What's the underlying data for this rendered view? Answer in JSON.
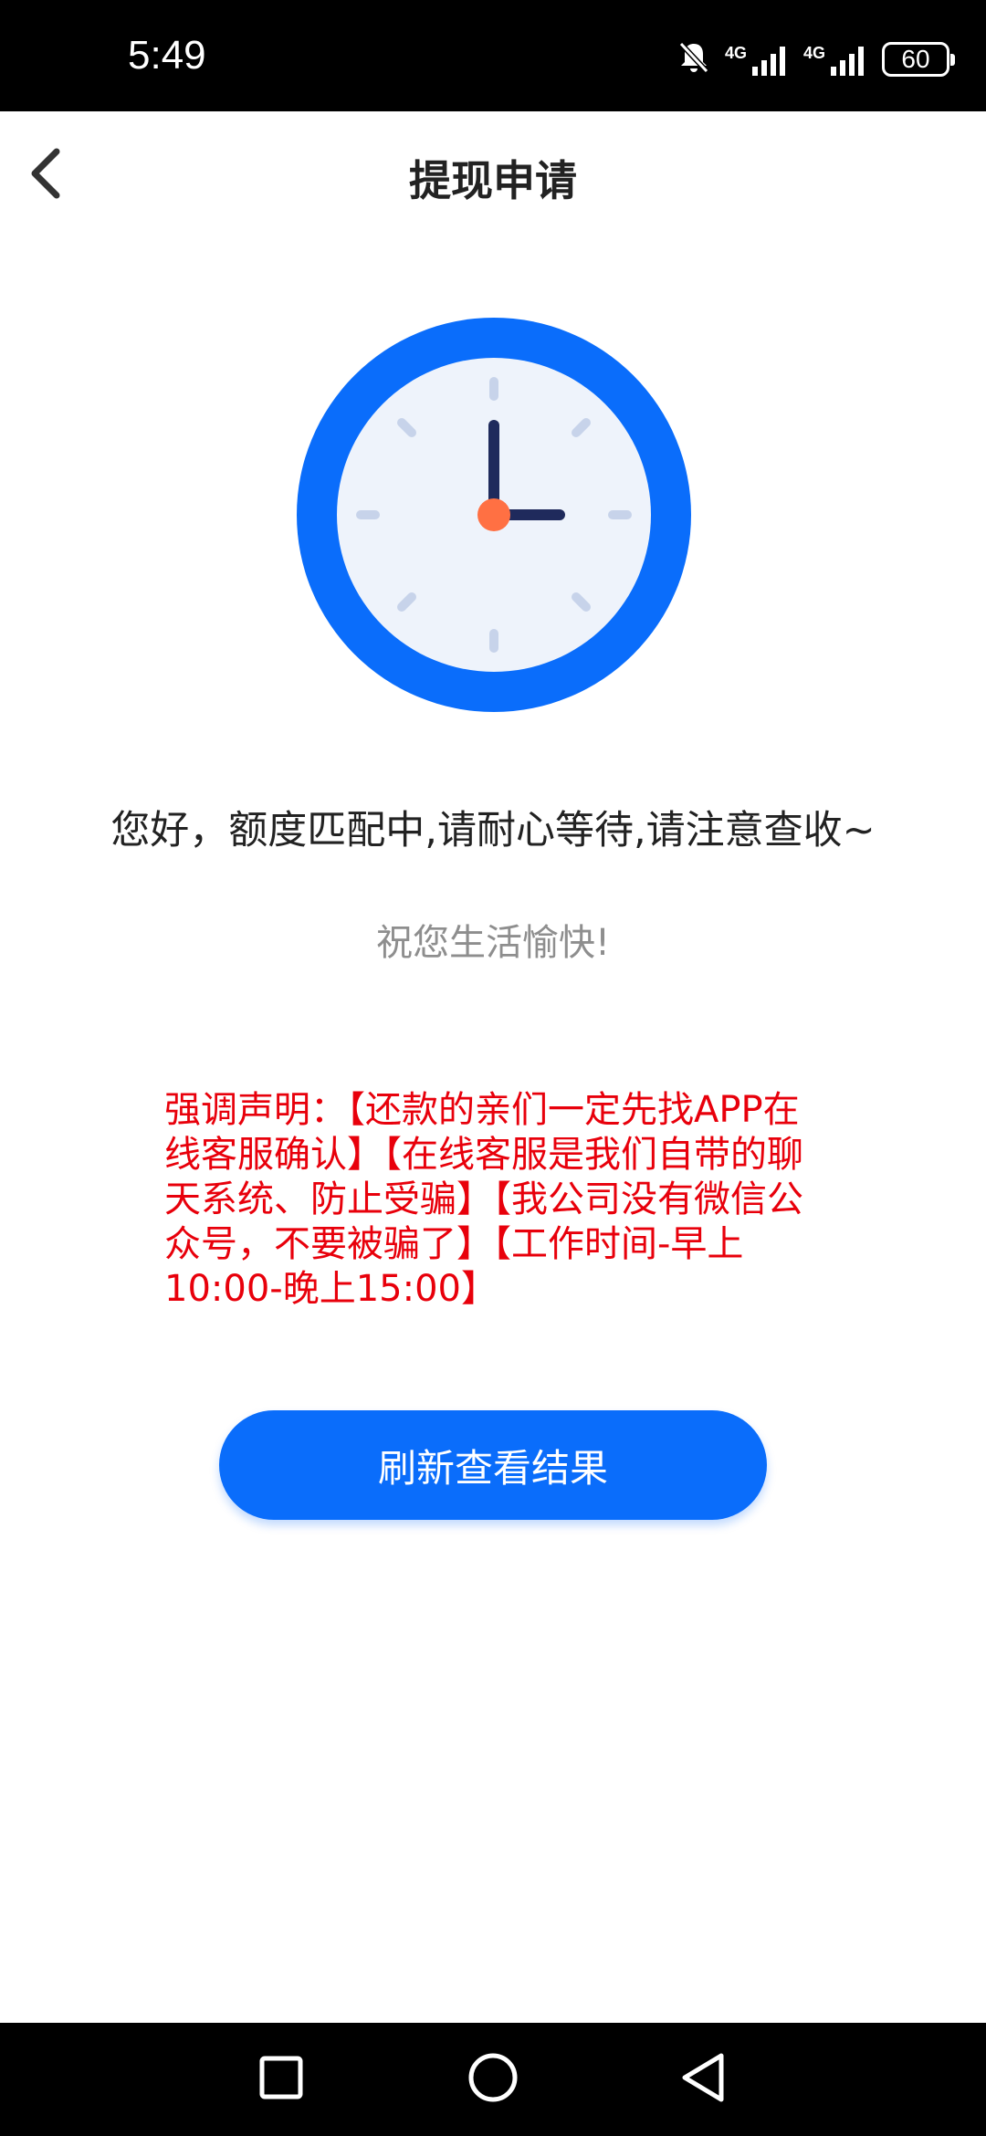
{
  "status_bar": {
    "time": "5:49",
    "net1_label": "4G",
    "net2_label": "4G",
    "battery": "60",
    "icons": [
      "bell-muted-icon",
      "signal-icon",
      "signal-icon",
      "battery-icon"
    ]
  },
  "header": {
    "title": "提现申请",
    "back_icon": "chevron-left-icon"
  },
  "content": {
    "illustration": "clock-icon",
    "main_message": "您好，额度匹配中,请耐心等待,请注意查收~",
    "sub_message": "祝您生活愉快!",
    "notice": "强调声明：【还款的亲们一定先找APP在线客服确认】【在线客服是我们自带的聊天系统、防止受骗】【我公司没有微信公众号，不要被骗了】【工作时间-早上10:00-晚上15:00】",
    "refresh_button": "刷新查看结果"
  },
  "nav_bar": {
    "buttons": [
      "recents-square-icon",
      "home-circle-icon",
      "back-triangle-icon"
    ]
  },
  "colors": {
    "accent": "#0a6dfb",
    "notice_red": "#e8000b",
    "clock_face": "#eef3fb",
    "clock_hand": "#1f2a5c",
    "clock_center": "#ff7043"
  }
}
